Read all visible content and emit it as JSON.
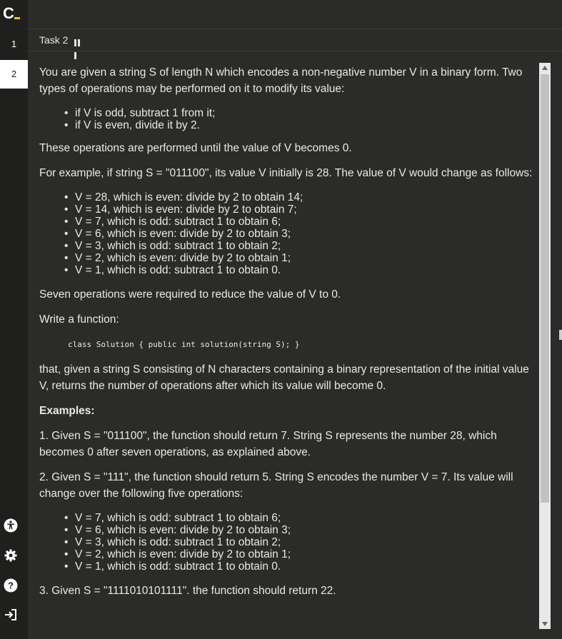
{
  "app": {
    "logo": "C"
  },
  "tasks": [
    {
      "label": "1"
    },
    {
      "label": "2"
    }
  ],
  "task_header": {
    "title": "Task 2"
  },
  "content": {
    "intro": "You are given a string S of length N which encodes a non-negative number V in a binary form. Two types of operations may be performed on it to modify its value:",
    "ops": [
      "if V is odd, subtract 1 from it;",
      "if V is even, divide it by 2."
    ],
    "until": "These operations are performed until the value of V becomes 0.",
    "example_intro": "For example, if string S = \"011100\", its value V initially is 28. The value of V would change as follows:",
    "steps1": [
      "V = 28, which is even: divide by 2 to obtain 14;",
      "V = 14, which is even: divide by 2 to obtain 7;",
      "V = 7, which is odd: subtract 1 to obtain 6;",
      "V = 6, which is even: divide by 2 to obtain 3;",
      "V = 3, which is odd: subtract 1 to obtain 2;",
      "V = 2, which is even: divide by 2 to obtain 1;",
      "V = 1, which is odd: subtract 1 to obtain 0."
    ],
    "seven_ops": "Seven operations were required to reduce the value of V to 0.",
    "write_fn": "Write a function:",
    "code": "class Solution { public int solution(string S); }",
    "that_given": "that, given a string S consisting of N characters containing a binary representation of the initial value V, returns the number of operations after which its value will become 0.",
    "examples_label": "Examples:",
    "ex1": "1. Given S = \"011100\", the function should return 7. String S represents the number 28, which becomes 0 after seven operations, as explained above.",
    "ex2": "2. Given S = \"111\", the function should return 5. String S encodes the number V = 7. Its value will change over the following five operations:",
    "steps2": [
      "V = 7, which is odd: subtract 1 to obtain 6;",
      "V = 6, which is even: divide by 2 to obtain 3;",
      "V = 3, which is odd: subtract 1 to obtain 2;",
      "V = 2, which is even: divide by 2 to obtain 1;",
      "V = 1, which is odd: subtract 1 to obtain 0."
    ],
    "ex3": "3. Given S = \"1111010101111\". the function should return 22."
  },
  "sidebar_icons": [
    "accessibility-icon",
    "gear-icon",
    "help-icon",
    "logout-icon"
  ]
}
